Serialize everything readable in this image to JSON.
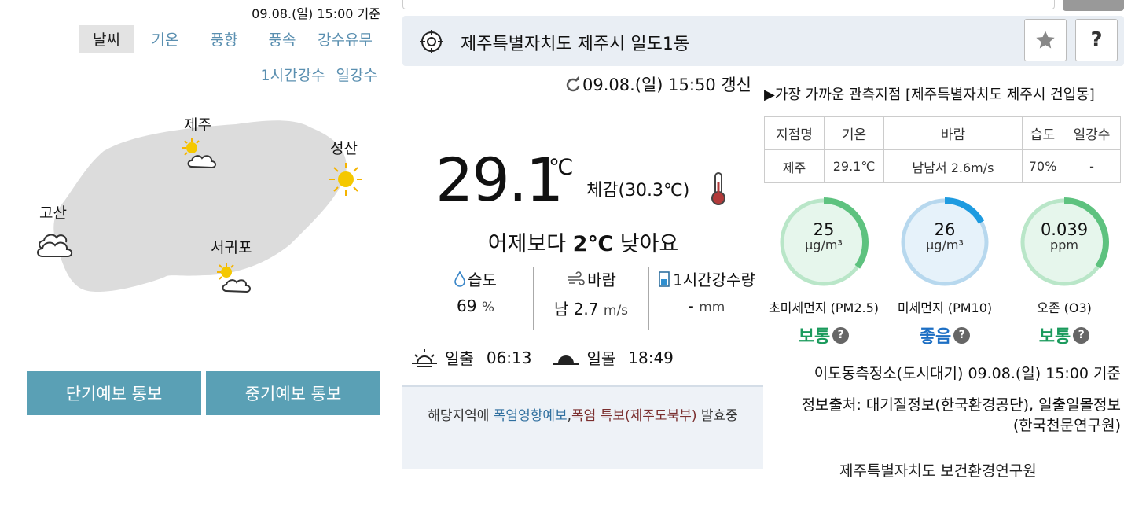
{
  "left": {
    "timestamp": "09.08.(일) 15:00 기준",
    "tabs": [
      {
        "label": "날씨",
        "active": true
      },
      {
        "label": "기온",
        "active": false
      },
      {
        "label": "풍향",
        "active": false
      },
      {
        "label": "풍속",
        "active": false
      },
      {
        "label": "강수유무",
        "active": false
      }
    ],
    "tabs2": [
      {
        "label": "1시간강수"
      },
      {
        "label": "일강수"
      }
    ],
    "cities": [
      {
        "name": "제주",
        "icon": "partly-cloudy-icon"
      },
      {
        "name": "성산",
        "icon": "sunny-icon"
      },
      {
        "name": "고산",
        "icon": "cloudy-icon"
      },
      {
        "name": "서귀포",
        "icon": "partly-cloudy-icon"
      }
    ],
    "buttons": {
      "short_term": "단기예보 통보",
      "mid_term": "중기예보 통보"
    }
  },
  "location": {
    "name": "제주특별자치도 제주시 일도1동",
    "star_icon": "star-icon",
    "help_label": "?"
  },
  "current": {
    "updated": "09.08.(일) 15:50 갱신",
    "temperature": "29.1",
    "unit": "℃",
    "feels_like": "체감(30.3℃)",
    "compare_prefix": "어제보다 ",
    "compare_value": "2℃",
    "compare_suffix": " 낮아요",
    "humidity_label": "습도",
    "humidity_value": "69",
    "humidity_unit": "%",
    "wind_label": "바람",
    "wind_value": "남 2.7",
    "wind_unit": "m/s",
    "rain_label": "1시간강수량",
    "rain_value": "-",
    "rain_unit": "mm",
    "sunrise_label": "일출",
    "sunrise_time": "06:13",
    "sunset_label": "일몰",
    "sunset_time": "18:49"
  },
  "notice": {
    "prefix": "해당지역에 ",
    "link1": "폭염영향예보",
    "sep": ",",
    "link2": "폭염 특보",
    "area": "(제주도북부)",
    "suffix": " 발효중"
  },
  "observation": {
    "nearest": "▶가장 가까운 관측지점 [제주특별자치도 제주시 건입동]",
    "headers": [
      "지점명",
      "기온",
      "바람",
      "습도",
      "일강수"
    ],
    "row": [
      "제주",
      "29.1℃",
      "남남서 2.6m/s",
      "70%",
      "-"
    ]
  },
  "air": {
    "items": [
      {
        "value": "25",
        "unit": "μg/m³",
        "name": "초미세먼지 (PM2.5)",
        "level": "보통",
        "level_color": "#1a9a5c",
        "ring_color": "#5ec27f",
        "bg_color": "#e6f6ec",
        "fraction": 0.35
      },
      {
        "value": "26",
        "unit": "μg/m³",
        "name": "미세먼지 (PM10)",
        "level": "좋음",
        "level_color": "#1d6fc4",
        "ring_color": "#1e9be0",
        "bg_color": "#e6f2fa",
        "fraction": 0.17
      },
      {
        "value": "0.039",
        "unit": "ppm",
        "name": "오존 (O3)",
        "level": "보통",
        "level_color": "#1a9a5c",
        "ring_color": "#5ec27f",
        "bg_color": "#e6f6ec",
        "fraction": 0.35
      }
    ],
    "station": "이도동측정소(도시대기) 09.08.(일) 15:00 기준",
    "source_line1": "정보출처: 대기질정보(한국환경공단), 일출일몰정보",
    "source_line2": "(한국천문연구원)",
    "institute": "제주특별자치도 보건환경연구원"
  }
}
